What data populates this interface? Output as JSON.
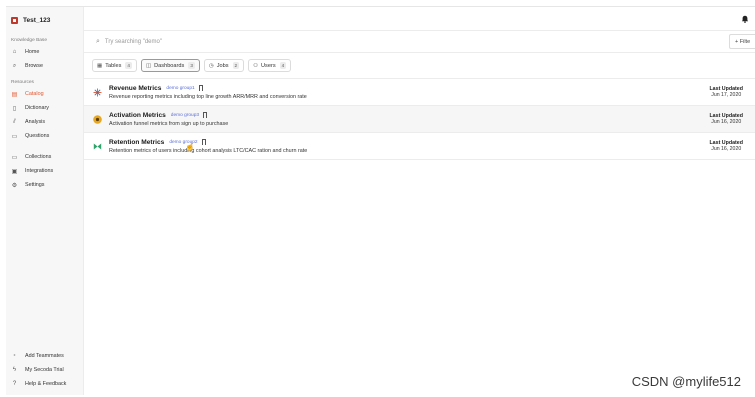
{
  "workspace": {
    "name": "Test_123"
  },
  "sidebar": {
    "section_knowledge": "Knowledge Base",
    "knowledge_items": [
      {
        "label": "Home",
        "icon": "home-icon"
      },
      {
        "label": "Browse",
        "icon": "search-icon"
      }
    ],
    "section_resources": "Resources",
    "resource_items": [
      {
        "label": "Catalog",
        "icon": "catalog-icon",
        "active": true
      },
      {
        "label": "Dictionary",
        "icon": "book-icon"
      },
      {
        "label": "Analysis",
        "icon": "chart-icon"
      },
      {
        "label": "Questions",
        "icon": "question-icon"
      }
    ],
    "other_items": [
      {
        "label": "Collections",
        "icon": "folder-icon"
      },
      {
        "label": "Integrations",
        "icon": "plug-icon"
      },
      {
        "label": "Settings",
        "icon": "gear-icon"
      }
    ],
    "bottom_items": [
      {
        "label": "Add Teammates",
        "icon": "add-user-icon"
      },
      {
        "label": "My Secoda Trial",
        "icon": "bolt-icon"
      },
      {
        "label": "Help & Feedback",
        "icon": "help-icon"
      }
    ]
  },
  "search": {
    "placeholder": "Try searching \"demo\"",
    "filter_label": "+ Filte"
  },
  "tabs": [
    {
      "label": "Tables",
      "count": "4",
      "icon": "table-icon"
    },
    {
      "label": "Dashboards",
      "count": "3",
      "icon": "dashboard-icon",
      "active": true
    },
    {
      "label": "Jobs",
      "count": "2",
      "icon": "clock-icon"
    },
    {
      "label": "Users",
      "count": "4",
      "icon": "users-icon"
    }
  ],
  "rows": [
    {
      "title": "Revenue Metrics",
      "group": "demo group1",
      "description": "Revenue reporting metrics including top line growth ARR/MRR and conversion rate",
      "updated_label": "Last Updated",
      "updated_date": "Jun 17, 2020"
    },
    {
      "title": "Activation Metrics",
      "group": "demo group3",
      "description": "Activation funnel metrics from sign up to purchase",
      "updated_label": "Last Updated",
      "updated_date": "Jun 16, 2020"
    },
    {
      "title": "Retention Metrics",
      "group": "demo group2",
      "description": "Retention metrics of users including cohort analysis LTC/CAC ration and churn rate",
      "updated_label": "Last Updated",
      "updated_date": "Jun 16, 2020"
    }
  ],
  "watermark": "CSDN @mylife512",
  "colors": {
    "accent": "#e4572e",
    "group_link": "#5a6fd6",
    "sidebar_bg": "#f7f7f8"
  }
}
